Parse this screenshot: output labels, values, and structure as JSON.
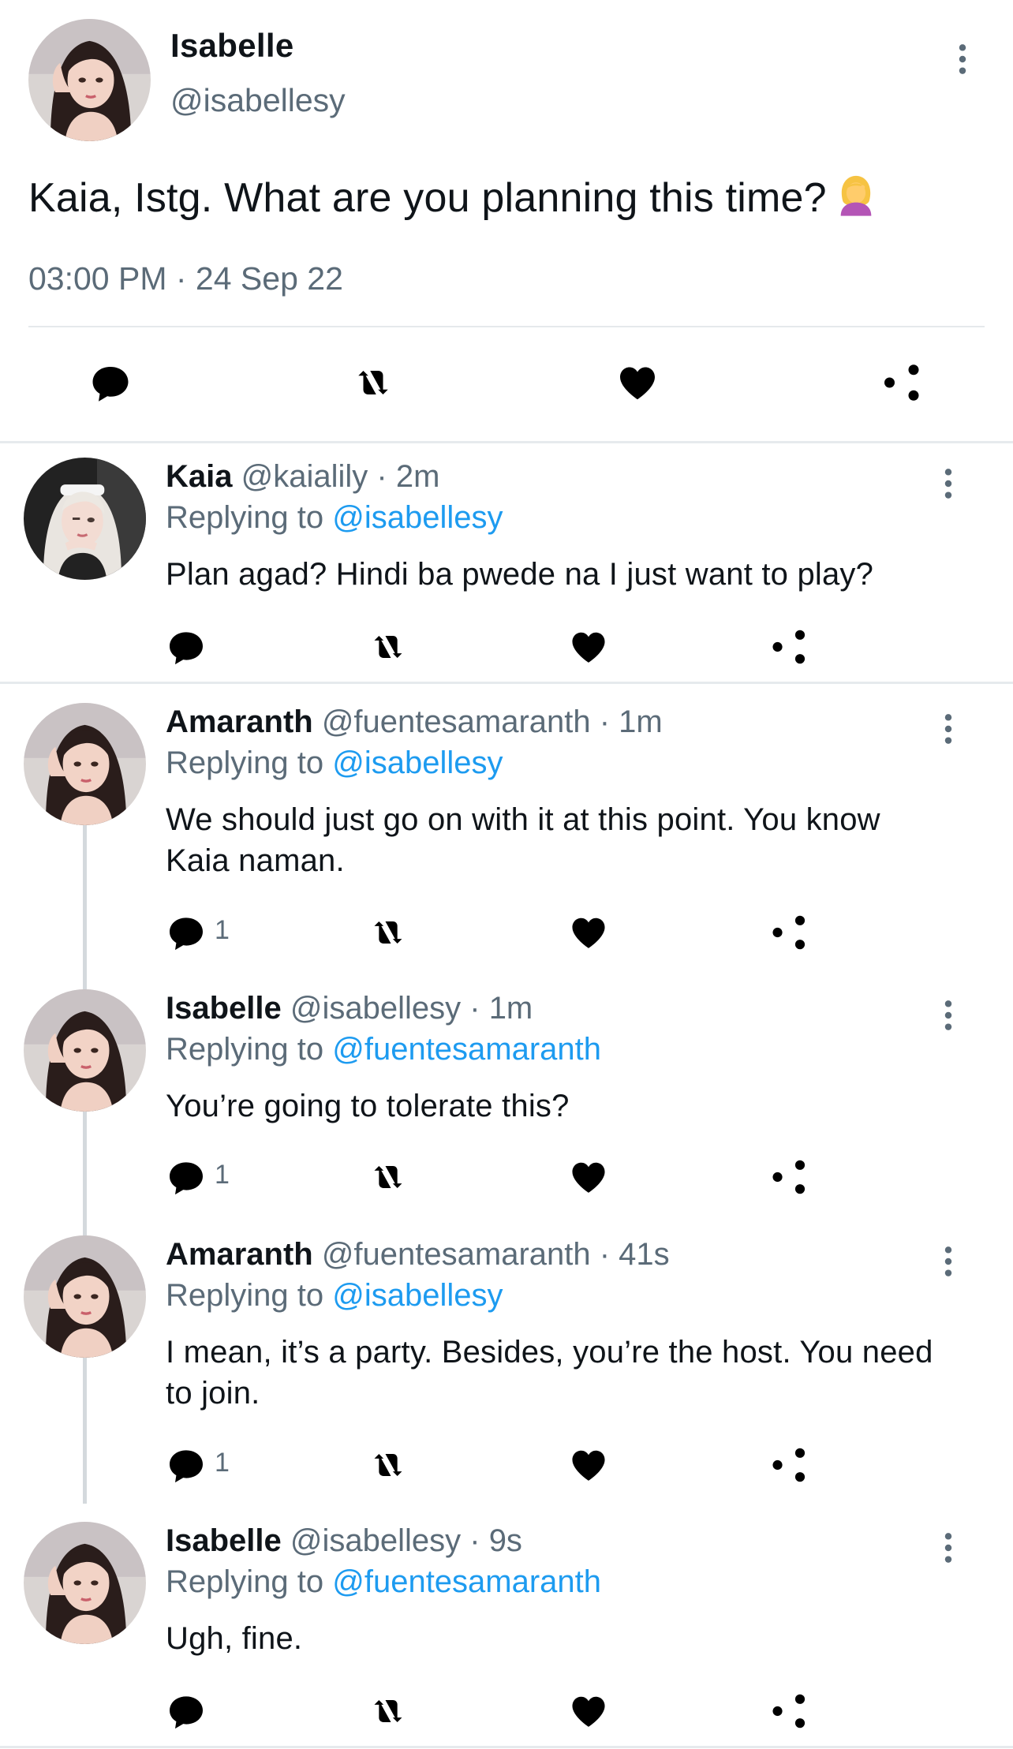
{
  "main_tweet": {
    "name": "Isabelle",
    "handle": "@isabellesy",
    "text": "Kaia, Istg. What are you planning this time?",
    "emoji_icon": "woman-facepalming-emoji",
    "timestamp": "03:00 PM · 24 Sep 22"
  },
  "replies": [
    {
      "name": "Kaia",
      "meta": "@kaialily · 2m",
      "replying_prefix": "Replying to ",
      "replying_to": "@isabellesy",
      "text": "Plan agad? Hindi ba pwede na I just want to play?",
      "reply_count": ""
    },
    {
      "name": "Amaranth",
      "meta": "@fuentesamaranth · 1m",
      "replying_prefix": "Replying to ",
      "replying_to": "@isabellesy",
      "text": "We should just go on with it at this point. You know Kaia naman.",
      "reply_count": "1"
    },
    {
      "name": "Isabelle",
      "meta": "@isabellesy · 1m",
      "replying_prefix": "Replying to ",
      "replying_to": "@fuentesamaranth",
      "text": "You’re going to tolerate this?",
      "reply_count": "1"
    },
    {
      "name": "Amaranth",
      "meta": "@fuentesamaranth · 41s",
      "replying_prefix": "Replying to ",
      "replying_to": "@isabellesy",
      "text": "I mean, it’s a party. Besides, you’re the host. You need to join.",
      "reply_count": "1"
    },
    {
      "name": "Isabelle",
      "meta": "@isabellesy · 9s",
      "replying_prefix": "Replying to ",
      "replying_to": "@fuentesamaranth",
      "text": "Ugh, fine.",
      "reply_count": ""
    }
  ],
  "colors": {
    "text": "#0f1419",
    "muted": "#5b6b78",
    "link": "#1d9bf0",
    "divider": "#e6eaed"
  }
}
